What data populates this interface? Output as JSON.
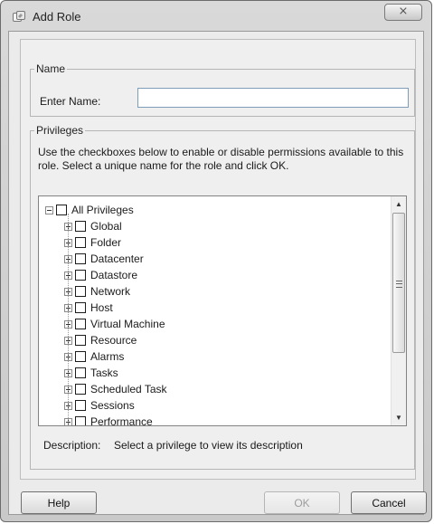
{
  "window": {
    "title": "Add Role",
    "close_glyph": "⨯"
  },
  "name_group": {
    "legend": "Name",
    "enter_label": "Enter Name:",
    "input_value": "",
    "input_placeholder": ""
  },
  "privileges_group": {
    "legend": "Privileges",
    "instructions": "Use the checkboxes below to enable or disable permissions available to this role. Select a unique name for the role and click OK.",
    "tree": {
      "root": {
        "label": "All Privileges",
        "expanded": true,
        "checked": false
      },
      "children": [
        {
          "label": "Global",
          "expanded": false,
          "checked": false
        },
        {
          "label": "Folder",
          "expanded": false,
          "checked": false
        },
        {
          "label": "Datacenter",
          "expanded": false,
          "checked": false
        },
        {
          "label": "Datastore",
          "expanded": false,
          "checked": false
        },
        {
          "label": "Network",
          "expanded": false,
          "checked": false
        },
        {
          "label": "Host",
          "expanded": false,
          "checked": false
        },
        {
          "label": "Virtual Machine",
          "expanded": false,
          "checked": false
        },
        {
          "label": "Resource",
          "expanded": false,
          "checked": false
        },
        {
          "label": "Alarms",
          "expanded": false,
          "checked": false
        },
        {
          "label": "Tasks",
          "expanded": false,
          "checked": false
        },
        {
          "label": "Scheduled Task",
          "expanded": false,
          "checked": false
        },
        {
          "label": "Sessions",
          "expanded": false,
          "checked": false
        },
        {
          "label": "Performance",
          "expanded": false,
          "checked": false
        }
      ]
    },
    "scrollbar": {
      "up_glyph": "▲",
      "down_glyph": "▼"
    },
    "description": {
      "label": "Description:",
      "text": "Select a privilege to view its description"
    }
  },
  "footer": {
    "help_label": "Help",
    "ok_label": "OK",
    "ok_enabled": false,
    "cancel_label": "Cancel"
  },
  "icons": {
    "app": "add-role-icon",
    "close": "close-icon",
    "expand": "plus-expander-icon",
    "collapse": "minus-expander-icon",
    "scroll_up": "arrow-up-icon",
    "scroll_down": "arrow-down-icon",
    "grip": "scroll-grip-icon"
  }
}
